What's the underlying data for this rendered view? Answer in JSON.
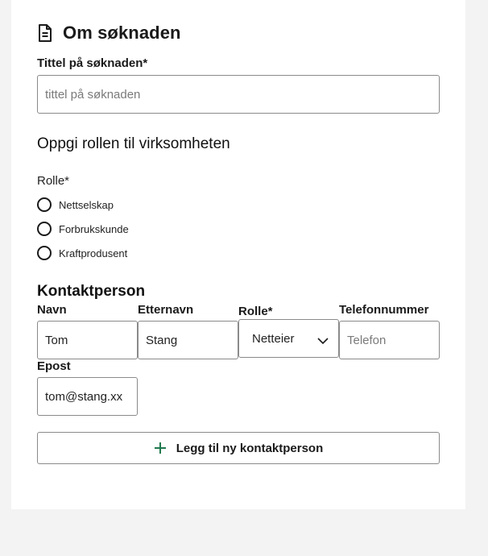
{
  "section": {
    "title": "Om søknaden",
    "icon": "document-icon"
  },
  "application_title": {
    "label": "Tittel på søknaden*",
    "placeholder": "tittel på søknaden",
    "value": ""
  },
  "role_section": {
    "heading": "Oppgi rollen til virksomheten",
    "field_label": "Rolle*",
    "options": [
      "Nettselskap",
      "Forbrukskunde",
      "Kraftprodusent"
    ]
  },
  "contact": {
    "heading": "Kontaktperson",
    "first_name": {
      "label": "Navn",
      "value": "Tom"
    },
    "last_name": {
      "label": "Etternavn",
      "value": "Stang"
    },
    "role": {
      "label": "Rolle*",
      "value": "Netteier"
    },
    "phone": {
      "label": "Telefonnummer",
      "placeholder": "Telefon",
      "value": ""
    },
    "email": {
      "label": "Epost",
      "value": "tom@stang.xx"
    },
    "add_button": "Legg til ny kontaktperson"
  },
  "colors": {
    "accent_green": "#1f7a4d",
    "page_bg": "#f3f3f4",
    "card_bg": "#ffffff"
  }
}
